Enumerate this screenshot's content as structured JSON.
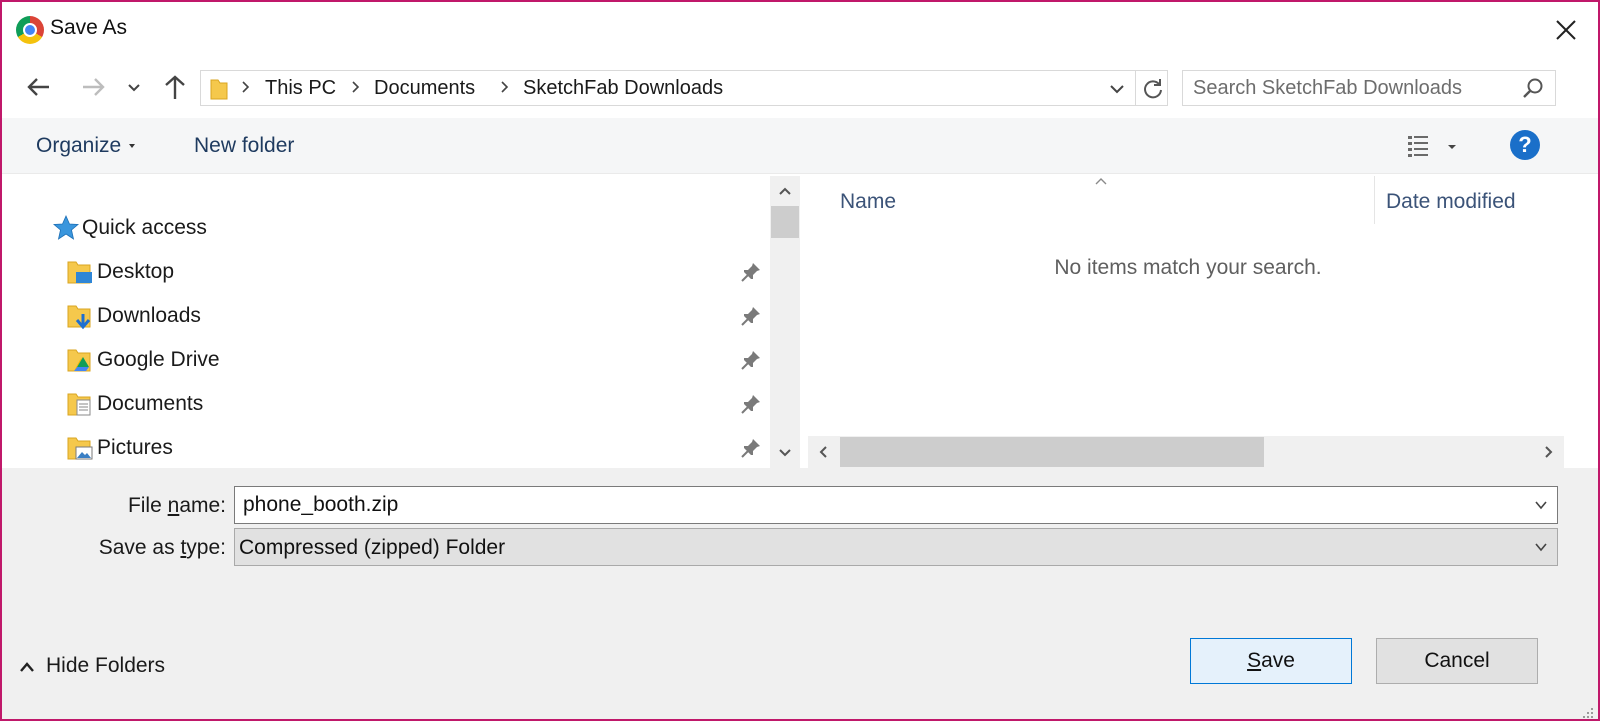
{
  "window": {
    "title": "Save As"
  },
  "address": {
    "crumbs": [
      "This PC",
      "Documents",
      "SketchFab Downloads"
    ]
  },
  "search": {
    "placeholder": "Search SketchFab Downloads"
  },
  "toolbar": {
    "organize_label": "Organize",
    "new_folder_label": "New folder",
    "help_label": "?"
  },
  "nav_pane": {
    "quick_access_label": "Quick access",
    "items": [
      {
        "label": "Desktop",
        "icon": "desktop-folder-icon"
      },
      {
        "label": "Downloads",
        "icon": "downloads-folder-icon"
      },
      {
        "label": "Google Drive",
        "icon": "google-drive-folder-icon"
      },
      {
        "label": "Documents",
        "icon": "documents-folder-icon"
      },
      {
        "label": "Pictures",
        "icon": "pictures-folder-icon"
      }
    ]
  },
  "file_list": {
    "columns": [
      "Name",
      "Date modified"
    ],
    "empty_message": "No items match your search."
  },
  "form": {
    "file_name_label_pre": "File ",
    "file_name_label_key": "n",
    "file_name_label_post": "ame:",
    "file_name_value": "phone_booth.zip",
    "save_type_label_pre": "Save as ",
    "save_type_label_key": "t",
    "save_type_label_post": "ype:",
    "save_type_value": "Compressed (zipped) Folder"
  },
  "footer": {
    "hide_folders_label": "Hide Folders",
    "save_label_key": "S",
    "save_label_rest": "ave",
    "cancel_label": "Cancel"
  },
  "colors": {
    "frame": "#c0186a",
    "accent": "#0078d7",
    "help": "#1a6fc9"
  }
}
